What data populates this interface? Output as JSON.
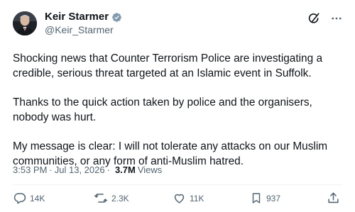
{
  "author": {
    "display_name": "Keir Starmer",
    "handle": "@Keir_Starmer",
    "verified": true
  },
  "body": {
    "paragraphs": [
      "Shocking news that Counter Terrorism Police are investigating a credible, serious threat targeted at an Islamic event in Suffolk.",
      "Thanks to the quick action taken by police and the organisers, nobody was hurt.",
      "My message is clear: I will not tolerate any attacks on our Muslim communities, or any form of anti-Muslim hatred."
    ]
  },
  "meta": {
    "time": "3:53 PM",
    "separator": "·",
    "date": "Jul 13, 2026",
    "views_count": "3.7M",
    "views_label": "Views"
  },
  "actions": {
    "replies": "14K",
    "reposts": "2.3K",
    "likes": "11K",
    "bookmarks": "937"
  },
  "icons": {
    "header": [
      "grok-icon",
      "more-icon"
    ],
    "actions": [
      "reply-icon",
      "repost-icon",
      "like-icon",
      "bookmark-icon",
      "share-icon"
    ]
  },
  "colors": {
    "text": "#0f1419",
    "secondary": "#536471",
    "verified": "#829aab",
    "divider": "#eff3f4"
  }
}
